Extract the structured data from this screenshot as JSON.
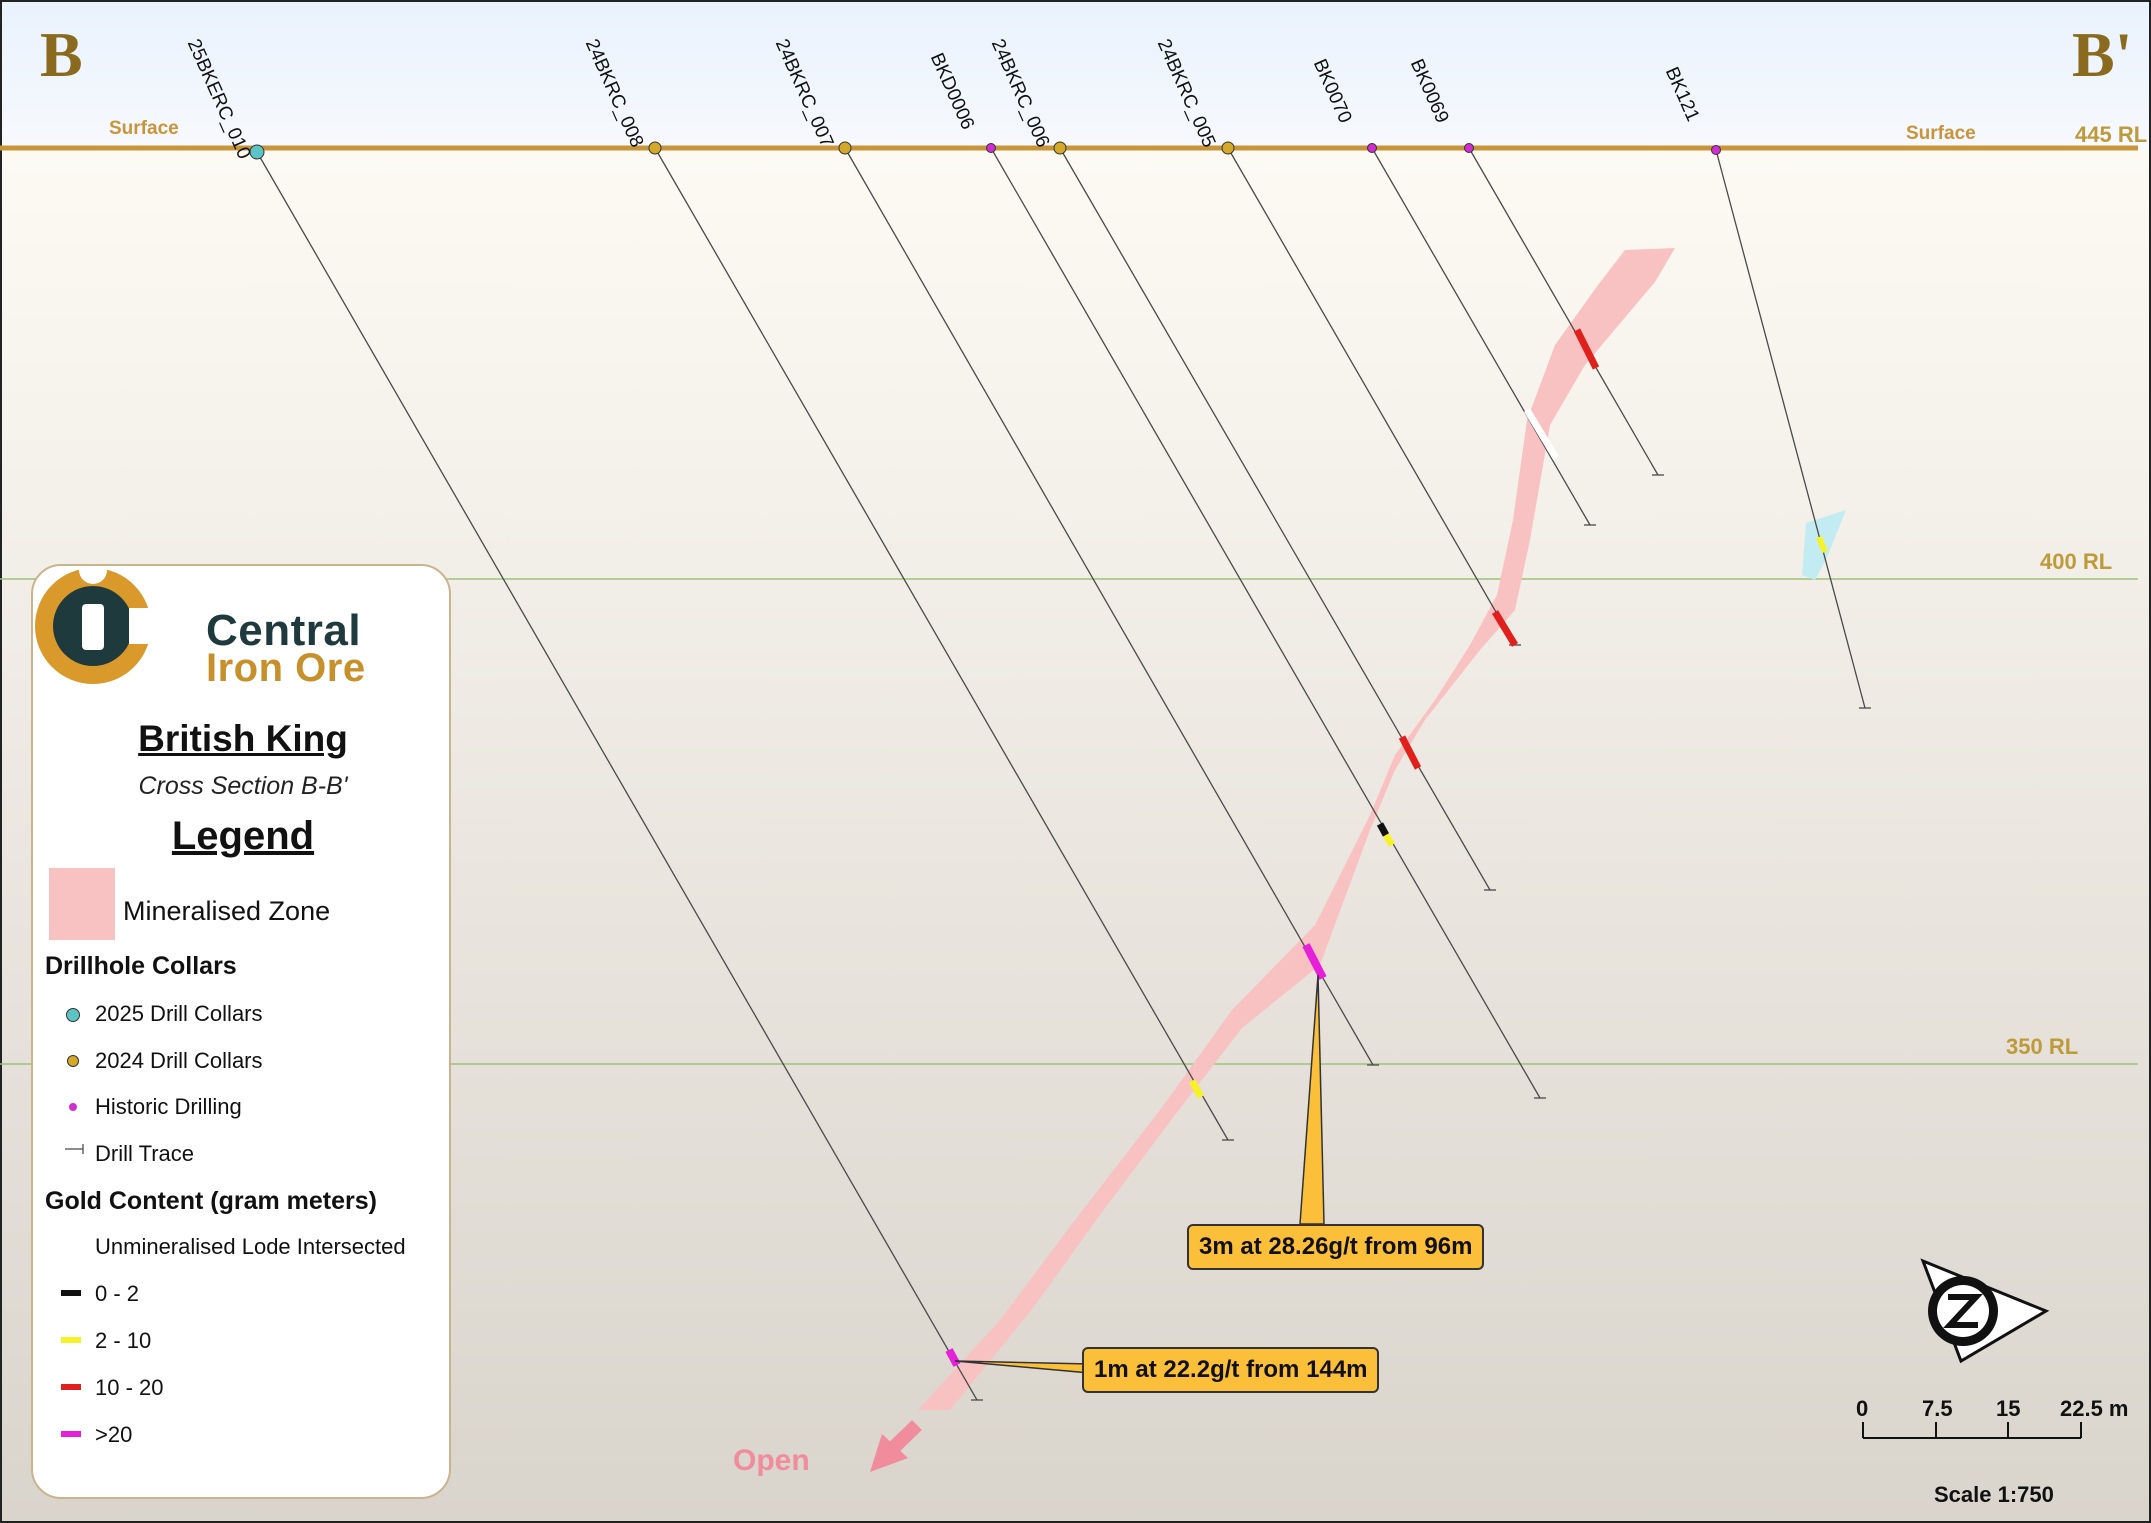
{
  "section": {
    "left_label": "B",
    "right_label": "B'",
    "surface_label": "Surface",
    "rl_labels": [
      "445 RL",
      "400 RL",
      "350 RL"
    ]
  },
  "drillholes": [
    {
      "name": "25BKERC_010",
      "type": "2025"
    },
    {
      "name": "24BKRC_008",
      "type": "2024"
    },
    {
      "name": "24BKRC_007",
      "type": "2024"
    },
    {
      "name": "BKD0006",
      "type": "historic"
    },
    {
      "name": "24BKRC_006",
      "type": "2024"
    },
    {
      "name": "24BKRC_005",
      "type": "2024"
    },
    {
      "name": "BK0070",
      "type": "historic"
    },
    {
      "name": "BK0069",
      "type": "historic"
    },
    {
      "name": "BK121",
      "type": "historic"
    }
  ],
  "callouts": {
    "upper": "3m at 28.26g/t from 96m",
    "lower": "1m at 22.2g/t from 144m"
  },
  "open_label": "Open",
  "legend": {
    "company_line1": "Central",
    "company_line2": "Iron Ore",
    "project": "British King",
    "subtitle": "Cross Section B-B'",
    "title": "Legend",
    "mineralised_zone": "Mineralised Zone",
    "collars_heading": "Drillhole Collars",
    "collar_items": [
      "2025 Drill Collars",
      "2024 Drill Collars",
      "Historic Drilling",
      "Drill Trace"
    ],
    "gold_heading": "Gold Content (gram meters)",
    "gold_items": [
      "Unmineralised Lode Intersected",
      "0 - 2",
      "2 - 10",
      "10 - 20",
      ">20"
    ]
  },
  "scale": {
    "ticks": [
      "0",
      "7.5",
      "15",
      "22.5 m"
    ],
    "ratio": "Scale 1:750"
  },
  "north_arrow": "N",
  "colors": {
    "collar_2025": "#5cc4c4",
    "collar_2024": "#d4a92a",
    "historic": "#d02ed0",
    "mineralised_zone": "#f9c2c2",
    "grade_0_2": "#111111",
    "grade_2_10": "#f5f22a",
    "grade_10_20": "#e0201c",
    "grade_gt20": "#e61fd9",
    "callout": "#fbbf3a"
  }
}
